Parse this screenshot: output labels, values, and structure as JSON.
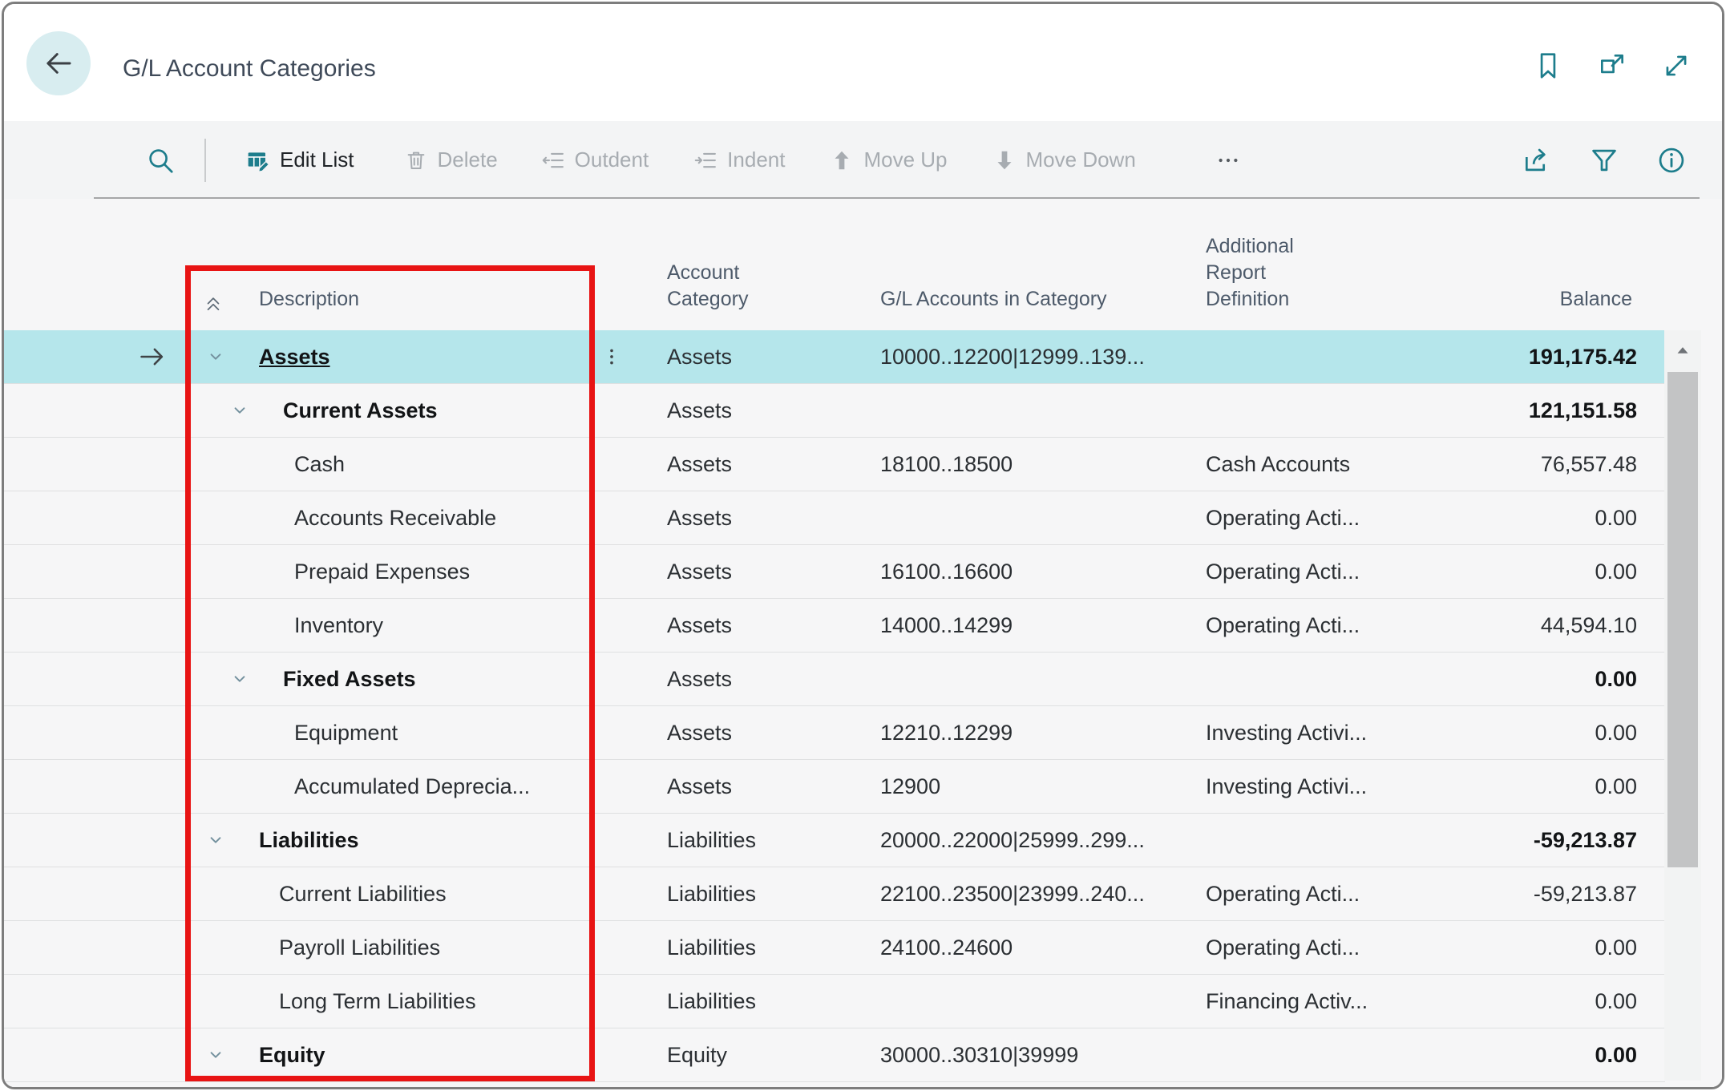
{
  "window": {
    "title": "G/L Account Categories"
  },
  "icons": {
    "header": [
      "back-arrow",
      "bookmark",
      "open-in-new-window",
      "expand-fullscreen"
    ],
    "toolbar": [
      "search",
      "edit-list",
      "delete-trash",
      "outdent",
      "indent",
      "move-up-arrow",
      "move-down-arrow",
      "more-ellipsis",
      "share",
      "filter-funnel",
      "info-circle"
    ],
    "table": [
      "collapse-all-double-chevron-up",
      "chevron-down",
      "selected-record-arrow",
      "kebab-vertical-dots",
      "scroll-up-triangle"
    ]
  },
  "toolbar": {
    "edit_list": "Edit List",
    "delete": "Delete",
    "outdent": "Outdent",
    "indent": "Indent",
    "move_up": "Move Up",
    "move_down": "Move Down",
    "more": "⋯",
    "enabled_color": "#1d7d8c",
    "disabled_color": "#a7acb1"
  },
  "table": {
    "headers": {
      "description": "Description",
      "account_category": "Account\nCategory",
      "gl_accounts": "G/L Accounts in Category",
      "additional_report_definition": "Additional\nReport\nDefinition",
      "balance": "Balance"
    },
    "rows": [
      {
        "description": "Assets",
        "category": "Assets",
        "gl_accounts": "10000..12200|12999..139...",
        "report_definition": "",
        "balance": "191,175.42",
        "indent": 1,
        "bold": true,
        "chevron": true,
        "selected": true
      },
      {
        "description": "Current Assets",
        "category": "Assets",
        "gl_accounts": "",
        "report_definition": "",
        "balance": "121,151.58",
        "indent": 2,
        "bold": true,
        "chevron": true,
        "selected": false
      },
      {
        "description": "Cash",
        "category": "Assets",
        "gl_accounts": "18100..18500",
        "report_definition": "Cash Accounts",
        "balance": "76,557.48",
        "indent": 3,
        "bold": false,
        "chevron": false,
        "selected": false
      },
      {
        "description": "Accounts Receivable",
        "category": "Assets",
        "gl_accounts": "",
        "report_definition": "Operating Acti...",
        "balance": "0.00",
        "indent": 3,
        "bold": false,
        "chevron": false,
        "selected": false
      },
      {
        "description": "Prepaid Expenses",
        "category": "Assets",
        "gl_accounts": "16100..16600",
        "report_definition": "Operating Acti...",
        "balance": "0.00",
        "indent": 3,
        "bold": false,
        "chevron": false,
        "selected": false
      },
      {
        "description": "Inventory",
        "category": "Assets",
        "gl_accounts": "14000..14299",
        "report_definition": "Operating Acti...",
        "balance": "44,594.10",
        "indent": 3,
        "bold": false,
        "chevron": false,
        "selected": false
      },
      {
        "description": "Fixed Assets",
        "category": "Assets",
        "gl_accounts": "",
        "report_definition": "",
        "balance": "0.00",
        "indent": 2,
        "bold": true,
        "chevron": true,
        "selected": false
      },
      {
        "description": "Equipment",
        "category": "Assets",
        "gl_accounts": "12210..12299",
        "report_definition": "Investing Activi...",
        "balance": "0.00",
        "indent": 3,
        "bold": false,
        "chevron": false,
        "selected": false
      },
      {
        "description": "Accumulated Deprecia...",
        "category": "Assets",
        "gl_accounts": "12900",
        "report_definition": "Investing Activi...",
        "balance": "0.00",
        "indent": 3,
        "bold": false,
        "chevron": false,
        "selected": false
      },
      {
        "description": "Liabilities",
        "category": "Liabilities",
        "gl_accounts": "20000..22000|25999..299...",
        "report_definition": "",
        "balance": "-59,213.87",
        "indent": 1,
        "bold": true,
        "chevron": true,
        "selected": false
      },
      {
        "description": "Current Liabilities",
        "category": "Liabilities",
        "gl_accounts": "22100..23500|23999..240...",
        "report_definition": "Operating Acti...",
        "balance": "-59,213.87",
        "indent": 2,
        "bold": false,
        "chevron": false,
        "selected": false
      },
      {
        "description": "Payroll Liabilities",
        "category": "Liabilities",
        "gl_accounts": "24100..24600",
        "report_definition": "Operating Acti...",
        "balance": "0.00",
        "indent": 2,
        "bold": false,
        "chevron": false,
        "selected": false
      },
      {
        "description": "Long Term Liabilities",
        "category": "Liabilities",
        "gl_accounts": "",
        "report_definition": "Financing Activ...",
        "balance": "0.00",
        "indent": 2,
        "bold": false,
        "chevron": false,
        "selected": false
      },
      {
        "description": "Equity",
        "category": "Equity",
        "gl_accounts": "30000..30310|39999",
        "report_definition": "",
        "balance": "0.00",
        "indent": 1,
        "bold": true,
        "chevron": true,
        "selected": false
      }
    ]
  },
  "annotation": {
    "type": "highlight-box",
    "around": "Description column",
    "color": "#e81414"
  },
  "colors": {
    "accent_teal": "#1d7d8c",
    "selected_row": "#b5e6eb",
    "header_text": "#4d5a6a",
    "toolbar_bg": "#f3f4f5",
    "table_bg": "#f6f6f7"
  }
}
